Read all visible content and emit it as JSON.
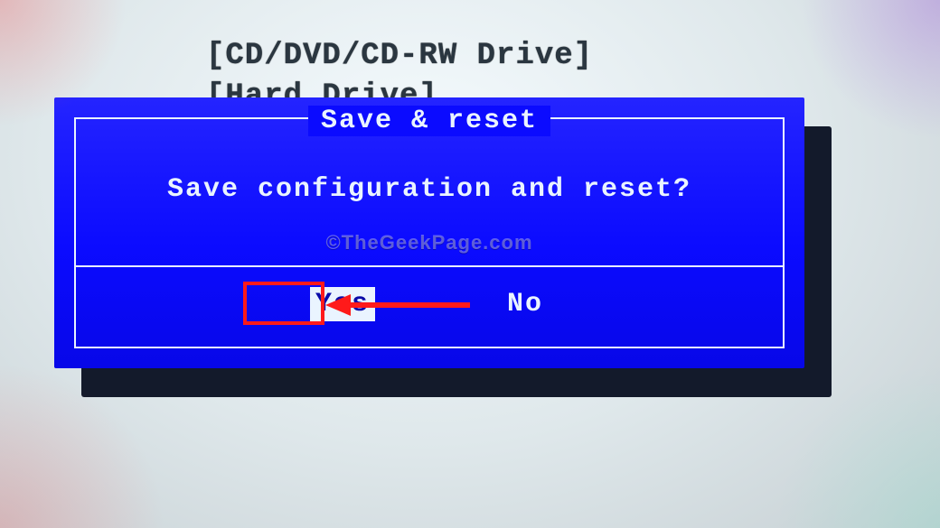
{
  "background_items": {
    "line1": "[CD/DVD/CD-RW Drive]",
    "line2": "[Hard Drive]"
  },
  "dialog": {
    "title": "Save & reset",
    "message": "Save configuration and reset?",
    "yes_label": "Yes",
    "no_label": "No",
    "selected": "yes"
  },
  "watermark": "©TheGeekPage.com",
  "colors": {
    "dialog_bg": "#0b0bff",
    "dialog_fg": "#eaf4ff",
    "annotation": "#ff1a1a"
  }
}
